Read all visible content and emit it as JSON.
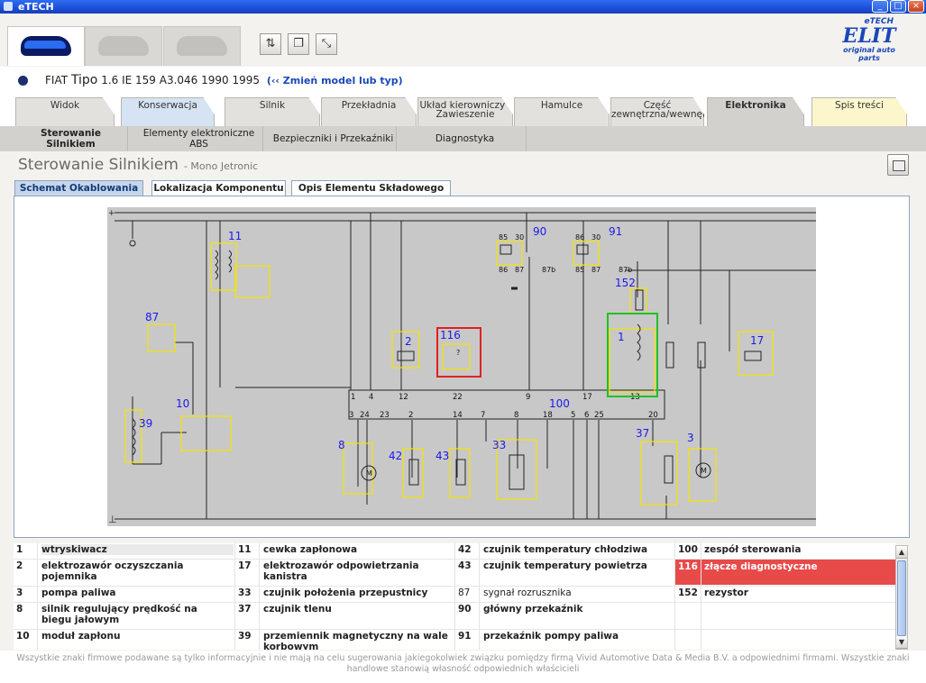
{
  "window": {
    "title": "eTECH",
    "minimize": "_",
    "maximize": "□",
    "close": "×"
  },
  "logo": {
    "prefix": "eTECH",
    "name": "ELIT",
    "tagline": "original auto parts"
  },
  "model": {
    "make": "FIAT",
    "model": "Tipo",
    "details": "1.6 IE 159 A3.046 1990 1995",
    "change_link": "(‹‹ Zmień model lub typ)"
  },
  "main_tabs": [
    {
      "label": "Widok"
    },
    {
      "label": "Konserwacja"
    },
    {
      "label": "Silnik"
    },
    {
      "label": "Przekładnia"
    },
    {
      "label": "Układ kierowniczy i Zawieszenie"
    },
    {
      "label": "Hamulce"
    },
    {
      "label": "Część zewnętrzna/wewnętrzna"
    },
    {
      "label": "Elektronika"
    },
    {
      "label": "Spis treści"
    }
  ],
  "sub_nav": [
    {
      "label": "Sterowanie Silnikiem"
    },
    {
      "label": "Elementy elektroniczne ABS"
    },
    {
      "label": "Bezpieczniki i Przekaźniki"
    },
    {
      "label": "Diagnostyka"
    }
  ],
  "page": {
    "title": "Sterowanie Silnikiem",
    "subtitle": "- Mono Jetronic"
  },
  "sub_tabs": [
    {
      "label": "Schemat Okablowania"
    },
    {
      "label": "Lokalizacja Komponentu"
    },
    {
      "label": "Opis Elementu Składowego"
    }
  ],
  "diagram": {
    "component_labels": [
      "11",
      "87",
      "10",
      "39",
      "2",
      "116",
      "90",
      "91",
      "152",
      "1",
      "17",
      "100",
      "8",
      "42",
      "43",
      "33",
      "37",
      "3"
    ],
    "ecu_top_pins": [
      "1",
      "4",
      "12",
      "22",
      "9",
      "17",
      "13"
    ],
    "ecu_bottom_pins": [
      "3",
      "24",
      "23",
      "2",
      "14",
      "7",
      "8",
      "18",
      "5",
      "6",
      "25",
      "20"
    ],
    "relay_pins_a": [
      "85",
      "30",
      "86",
      "87",
      "87b"
    ],
    "relay_pins_b": [
      "86",
      "30",
      "85",
      "87",
      "87b"
    ]
  },
  "legend": [
    [
      {
        "num": "1",
        "text": "wtryskiwacz"
      },
      {
        "num": "2",
        "text": "elektrozawór oczyszczania pojemnika"
      },
      {
        "num": "3",
        "text": "pompa paliwa"
      },
      {
        "num": "8",
        "text": "silnik regulujący prędkość na biegu jałowym"
      },
      {
        "num": "10",
        "text": "moduł zapłonu"
      }
    ],
    [
      {
        "num": "11",
        "text": "cewka zapłonowa"
      },
      {
        "num": "17",
        "text": "elektrozawór odpowietrzania kanistra"
      },
      {
        "num": "33",
        "text": "czujnik położenia przepustnicy"
      },
      {
        "num": "37",
        "text": "czujnik tlenu"
      },
      {
        "num": "39",
        "text": "przemiennik magnetyczny na wale korbowym"
      }
    ],
    [
      {
        "num": "42",
        "text": "czujnik temperatury chłodziwa"
      },
      {
        "num": "43",
        "text": "czujnik temperatury powietrza"
      },
      {
        "num": "87",
        "text": "sygnał rozrusznika"
      },
      {
        "num": "90",
        "text": "główny przekaźnik"
      },
      {
        "num": "91",
        "text": "przekaźnik pompy paliwa"
      }
    ],
    [
      {
        "num": "100",
        "text": "zespół sterowania"
      },
      {
        "num": "116",
        "text": "złącze diagnostyczne"
      },
      {
        "num": "152",
        "text": "rezystor"
      },
      {
        "num": "",
        "text": ""
      },
      {
        "num": "",
        "text": ""
      }
    ]
  ],
  "footer": "Wszystkie znaki firmowe podawane są tylko informacyjnie i nie mają na celu sugerowania jakiegokolwiek związku pomiędzy firmą Vivid Automotive Data & Media B.V. a odpowiednimi firmami. Wszystkie znaki handlowe stanowią własność odpowiednich właścicieli",
  "colors": {
    "highlight": "#e84a4a",
    "component": "#f2e400",
    "label": "#1a1aee",
    "diag_red": "#e02020",
    "diag_green": "#21c021"
  }
}
